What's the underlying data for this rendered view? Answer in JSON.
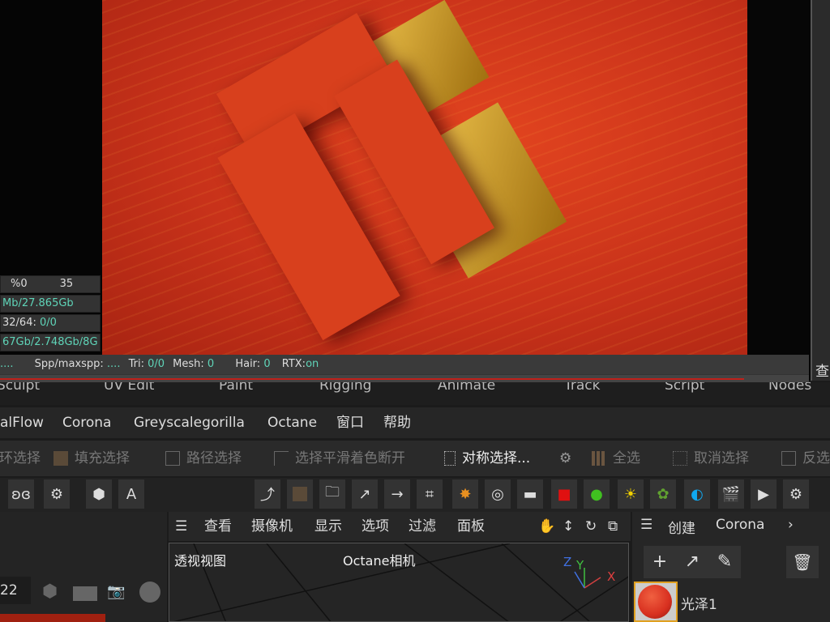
{
  "stats": {
    "row1a": "%0",
    "row1b": "35",
    "row2": "Mb/27.865Gb",
    "row3_label": "32/64: ",
    "row3_val": "0/0",
    "row4": "67Gb/2.748Gb/8G"
  },
  "status": {
    "dots": "....",
    "spp_label": "Spp/maxspp: ",
    "spp_val": "....",
    "tri_label": "Tri: ",
    "tri_val": "0/0",
    "mesh_label": "Mesh: ",
    "mesh_val": "0",
    "hair_label": "Hair: ",
    "hair_val": "0",
    "rtx_label": "RTX:",
    "rtx_val": "on"
  },
  "render_progress_percent": 92,
  "right_panel_char": "查",
  "layouts": [
    "Sculpt",
    "UV Edit",
    "Paint",
    "Rigging",
    "Animate",
    "Track",
    "Script",
    "Nodes"
  ],
  "menu": [
    "alFlow",
    "Corona",
    "Greyscalegorilla",
    "Octane",
    "窗口",
    "帮助"
  ],
  "toolbar": [
    "循环选择",
    "填充选择",
    "路径选择",
    "选择平滑着色断开",
    "对称选择...",
    "全选",
    "取消选择",
    "反选"
  ],
  "frame_value": "22",
  "viewport_menu": [
    "查看",
    "摄像机",
    "显示",
    "选项",
    "过滤",
    "面板"
  ],
  "viewport": {
    "view_name": "透视视图",
    "camera": "Octane相机",
    "axes": {
      "x": "X",
      "y": "Y",
      "z": "Z"
    }
  },
  "right_panel": {
    "tabs": [
      "创建",
      "Corona"
    ],
    "material": "光泽1"
  },
  "colors": {
    "accent_teal": "#5fd4b8",
    "progress_red": "#c0201a",
    "material_red": "#d83020"
  }
}
